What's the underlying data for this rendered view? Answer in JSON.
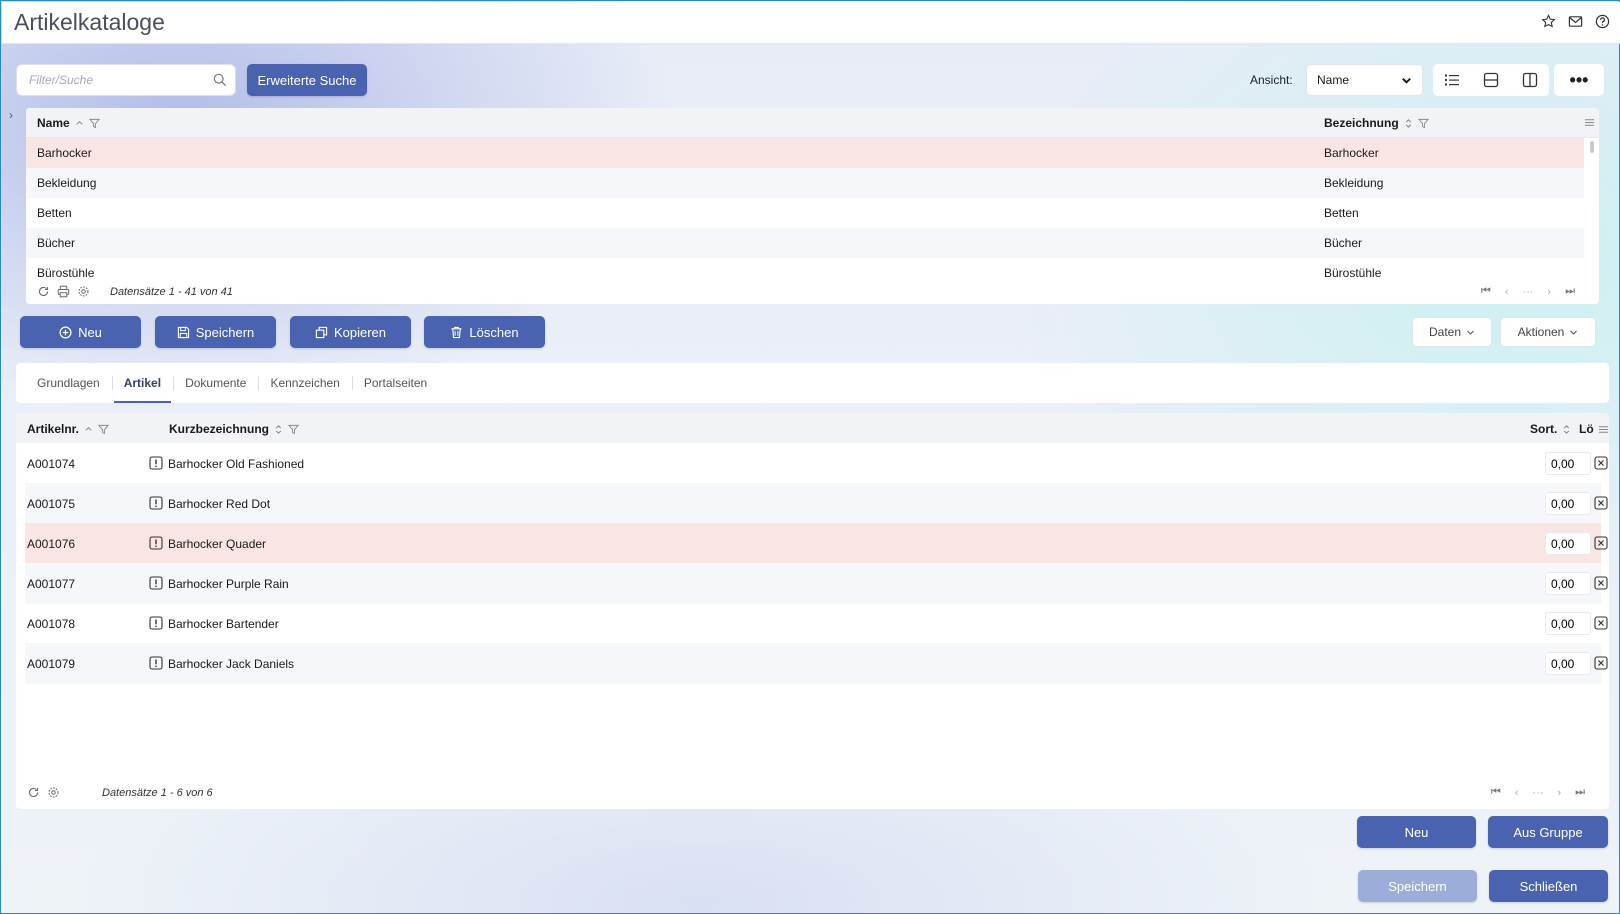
{
  "window": {
    "title": "Artikelkataloge"
  },
  "toolbar": {
    "search_placeholder": "Filter/Suche",
    "advanced_search_label": "Erweiterte Suche",
    "view_label": "Ansicht:",
    "view_selected": "Name"
  },
  "catalog_grid": {
    "columns": [
      {
        "label": "Name",
        "sort": "ascending"
      },
      {
        "label": "Bezeichnung",
        "sort": "none"
      }
    ],
    "rows": [
      {
        "name": "Barhocker",
        "bezeichnung": "Barhocker",
        "selected": true
      },
      {
        "name": "Bekleidung",
        "bezeichnung": "Bekleidung"
      },
      {
        "name": "Betten",
        "bezeichnung": "Betten"
      },
      {
        "name": "Bücher",
        "bezeichnung": "Bücher"
      },
      {
        "name": "Bürostühle",
        "bezeichnung": "Bürostühle"
      }
    ],
    "record_text": "Datensätze 1 - 41 von 41"
  },
  "actions": {
    "neu": "Neu",
    "speichern": "Speichern",
    "kopieren": "Kopieren",
    "loeschen": "Löschen",
    "daten": "Daten",
    "aktionen": "Aktionen"
  },
  "tabs": [
    {
      "label": "Grundlagen"
    },
    {
      "label": "Artikel",
      "active": true
    },
    {
      "label": "Dokumente"
    },
    {
      "label": "Kennzeichen"
    },
    {
      "label": "Portalseiten"
    }
  ],
  "article_grid": {
    "columns": [
      "Artikelnr.",
      "Kurzbezeichnung",
      "Sort.",
      "Lö"
    ],
    "rows": [
      {
        "nr": "A001074",
        "desc": "Barhocker Old Fashioned",
        "sort": "0,00"
      },
      {
        "nr": "A001075",
        "desc": "Barhocker Red Dot",
        "sort": "0,00"
      },
      {
        "nr": "A001076",
        "desc": "Barhocker Quader",
        "sort": "0,00",
        "selected": true
      },
      {
        "nr": "A001077",
        "desc": "Barhocker Purple Rain",
        "sort": "0,00"
      },
      {
        "nr": "A001078",
        "desc": "Barhocker Bartender",
        "sort": "0,00"
      },
      {
        "nr": "A001079",
        "desc": "Barhocker Jack Daniels",
        "sort": "0,00"
      }
    ],
    "record_text": "Datensätze 1 - 6 von 6"
  },
  "bottom": {
    "neu": "Neu",
    "aus_gruppe": "Aus Gruppe",
    "speichern": "Speichern",
    "schliessen": "Schließen"
  },
  "colors": {
    "primary": "#4a63b0",
    "disabled": "#9badd8",
    "selected_row": "#f9e5e4",
    "frame_border": "#2a8ab8"
  },
  "icons": [
    "star-icon",
    "mail-icon",
    "help-icon",
    "search-icon",
    "list-view-icon",
    "split-horizontal-icon",
    "split-vertical-icon",
    "more-icon",
    "filter-icon",
    "sort-icon",
    "refresh-icon",
    "print-icon",
    "settings-icon",
    "first-page-icon",
    "prev-page-icon",
    "next-page-icon",
    "last-page-icon",
    "plus-circle-icon",
    "save-icon",
    "copy-icon",
    "trash-icon",
    "chevron-down-icon",
    "warning-icon",
    "delete-box-icon",
    "column-menu-icon"
  ]
}
